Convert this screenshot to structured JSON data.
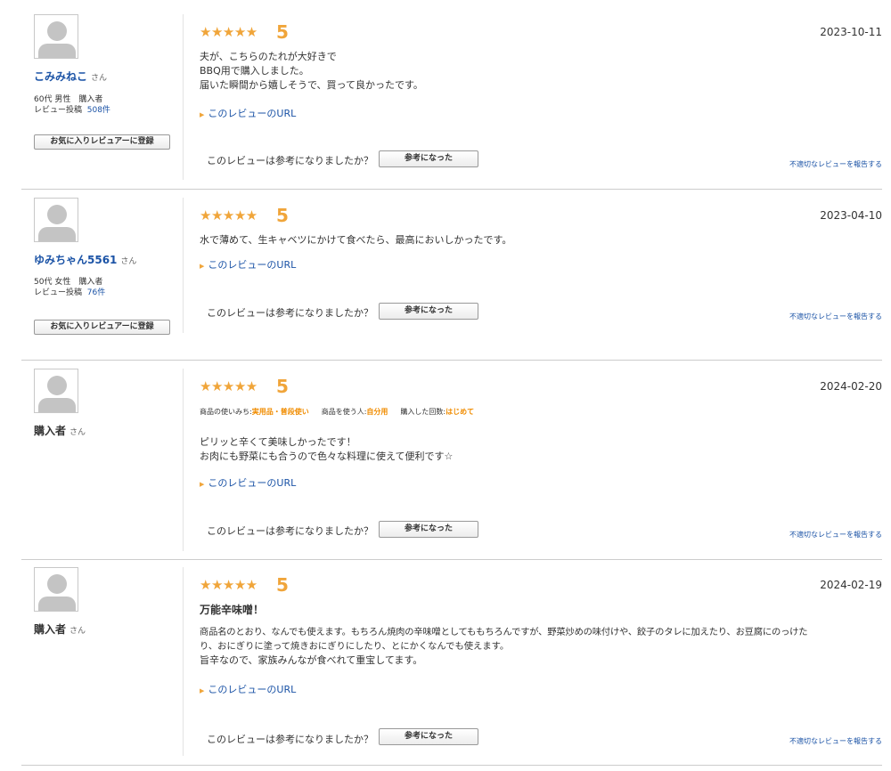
{
  "labels": {
    "san": "さん",
    "fav_button": "お気に入りレビュアーに登録",
    "url_link": "このレビューのURL",
    "helpful_question": "このレビューは参考になりましたか？",
    "helpful_button": "参考になった",
    "report_link": "不適切なレビューを報告する",
    "review_count_label": "レビュー投稿"
  },
  "reviews": [
    {
      "reviewer": {
        "name": "こみみねこ",
        "demo": "60代 男性　購入者",
        "review_count": "508件"
      },
      "stars": "★★★★★",
      "score": "5",
      "date": "2023-10-11",
      "lines": [
        "夫が、こちらのたれが大好きで",
        "BBQ用で購入しました。",
        "届いた瞬間から嬉しそうで、買って良かったです。"
      ]
    },
    {
      "reviewer": {
        "name": "ゆみちゃん5561",
        "demo": "50代 女性　購入者",
        "review_count": "76件"
      },
      "stars": "★★★★★",
      "score": "5",
      "date": "2023-04-10",
      "lines": [
        "水で薄めて、生キャベツにかけて食べたら、最高においしかったです。"
      ]
    },
    {
      "reviewer": {
        "name": "購入者"
      },
      "stars": "★★★★★",
      "score": "5",
      "date": "2024-02-20",
      "tags": [
        {
          "label": "商品の使いみち:",
          "value": "実用品・普段使い"
        },
        {
          "label": "商品を使う人:",
          "value": "自分用"
        },
        {
          "label": "購入した回数:",
          "value": "はじめて"
        }
      ],
      "lines": [
        "ピリッと辛くて美味しかったです！",
        "お肉にも野菜にも合うので色々な料理に使えて便利です☆"
      ]
    },
    {
      "reviewer": {
        "name": "購入者"
      },
      "stars": "★★★★★",
      "score": "5",
      "date": "2024-02-19",
      "title": "万能辛味噌！",
      "lines": [
        "商品名のとおり、なんでも使えます。もちろん焼肉の辛味噌としてももちろんですが、野菜炒めの味付けや、餃子のタレに加えたり、お豆腐にのっけた",
        "り、おにぎりに塗って焼きおにぎりにしたり、とにかくなんでも使えます。",
        "旨辛なので、家族みんなが食べれて重宝してます。"
      ]
    }
  ]
}
